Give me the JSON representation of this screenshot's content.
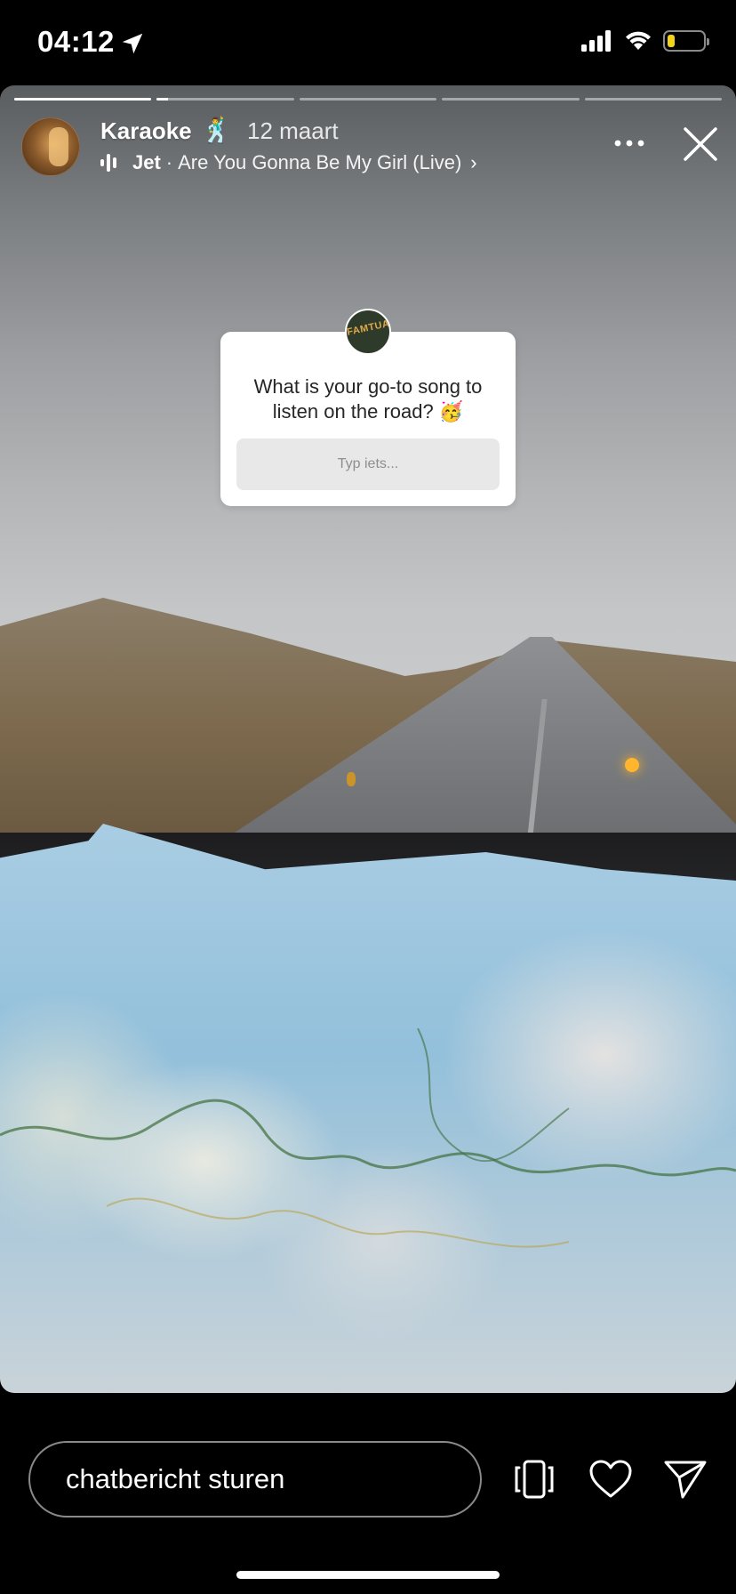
{
  "status_bar": {
    "time": "04:12",
    "location_icon": "location-arrow-icon",
    "signal_icon": "cellular-signal-icon",
    "wifi_icon": "wifi-icon",
    "battery_icon": "battery-icon",
    "battery_level": 0.2,
    "battery_color": "#f2d21b"
  },
  "story": {
    "progress": {
      "segments": 5,
      "current_index": 0,
      "current_fraction": 1.0,
      "next_fraction": 0.08
    },
    "header": {
      "username": "Karaoke",
      "username_emoji": "🕺",
      "date": "12 maart",
      "music": {
        "icon": "equalizer-icon",
        "artist": "Jet",
        "separator": "·",
        "track": "Are You Gonna Be My Girl (Live)",
        "chevron": "›"
      },
      "more_icon": "more-options-icon",
      "close_icon": "close-icon"
    },
    "sticker": {
      "avatar_text": "FAMTUAN",
      "question": "What is your go-to song to listen on the road? 🥳",
      "placeholder": "Typ iets..."
    }
  },
  "bottom_bar": {
    "message_placeholder": "chatbericht sturen",
    "icons": [
      "rotate-phone-icon",
      "heart-icon",
      "send-icon"
    ]
  }
}
